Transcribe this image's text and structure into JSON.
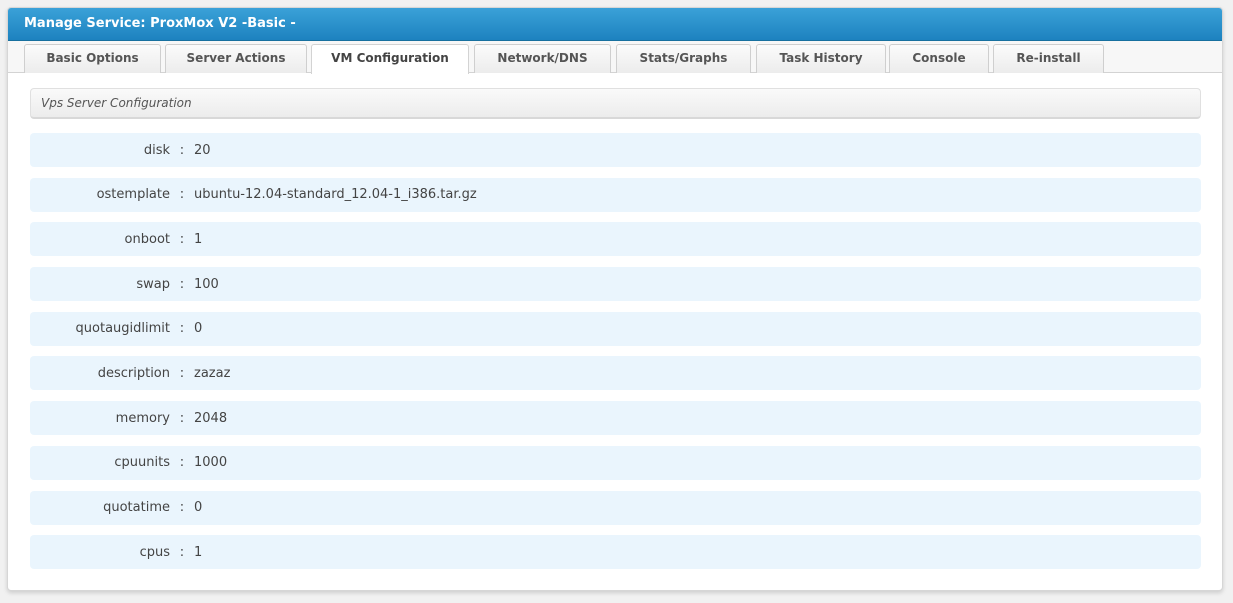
{
  "header": {
    "title": "Manage Service: ProxMox V2 -Basic -"
  },
  "tabs": [
    {
      "label": "Basic Options"
    },
    {
      "label": "Server Actions"
    },
    {
      "label": "VM Configuration"
    },
    {
      "label": "Network/DNS"
    },
    {
      "label": "Stats/Graphs"
    },
    {
      "label": "Task History"
    },
    {
      "label": "Console"
    },
    {
      "label": "Re-install"
    }
  ],
  "active_tab": "VM Configuration",
  "section": {
    "title": "Vps Server Configuration"
  },
  "separator": ":",
  "config_rows": [
    {
      "key": "disk",
      "value": "20"
    },
    {
      "key": "ostemplate",
      "value": "ubuntu-12.04-standard_12.04-1_i386.tar.gz"
    },
    {
      "key": "onboot",
      "value": "1"
    },
    {
      "key": "swap",
      "value": "100"
    },
    {
      "key": "quotaugidlimit",
      "value": "0"
    },
    {
      "key": "description",
      "value": "zazaz"
    },
    {
      "key": "memory",
      "value": "2048"
    },
    {
      "key": "cpuunits",
      "value": "1000"
    },
    {
      "key": "quotatime",
      "value": "0"
    },
    {
      "key": "cpus",
      "value": "1"
    }
  ],
  "colors": {
    "header_top": "#3aa1d8",
    "header_bottom": "#1d82bf",
    "row_bg": "#eaf5fd"
  }
}
